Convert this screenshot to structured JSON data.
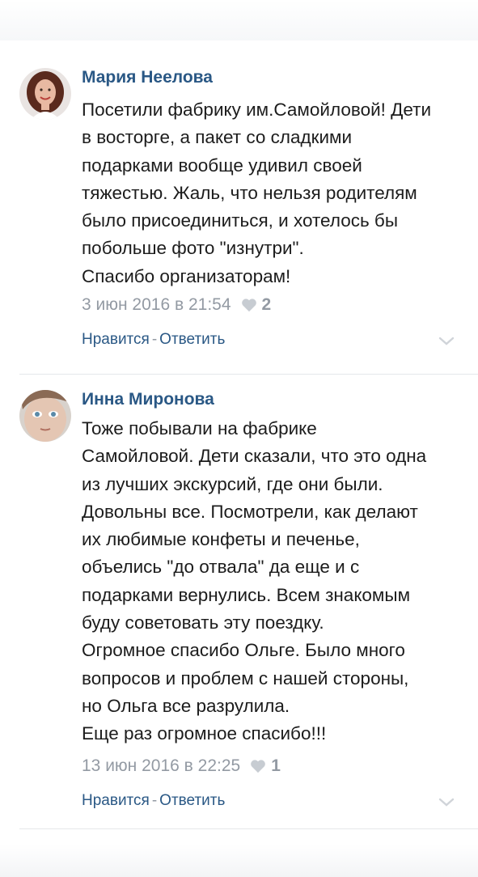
{
  "colors": {
    "link": "#2a5885",
    "meta": "#939aa3",
    "text": "#1c1c1c",
    "divider": "#e5e7ea"
  },
  "comments": [
    {
      "author": "Мария Неелова",
      "text": "Посетили фабрику им.Самойловой! Дети\nв восторге, а пакет со сладкими\nподарками вообще удивил своей\nтяжестью. Жаль, что нельзя родителям\nбыло присоединиться, и хотелось бы\nпобольше фото \"изнутри\".\nСпасибо организаторам!",
      "date": "3 июн 2016 в 21:54",
      "likes": "2",
      "like_label": "Нравится",
      "separator": "-",
      "reply_label": "Ответить",
      "icons": {
        "heart": "heart-icon",
        "chevron": "chevron-down-icon"
      }
    },
    {
      "author": "Инна Миронова",
      "text": "Тоже побывали на фабрике\nСамойловой. Дети сказали, что это одна\nиз лучших экскурсий, где они были.\nДовольны все. Посмотрели, как делают\nих любимые конфеты и печенье,\nобъелись \"до отвала\" да еще и с\nподарками вернулись. Всем знакомым\nбуду советовать эту поездку.\nОгромное спасибо Ольге. Было много\nвопросов и проблем с нашей стороны,\nно Ольга все разрулила.\nЕще раз огромное спасибо!!!",
      "date": "13 июн 2016 в 22:25",
      "likes": "1",
      "like_label": "Нравится",
      "separator": "-",
      "reply_label": "Ответить",
      "icons": {
        "heart": "heart-icon",
        "chevron": "chevron-down-icon"
      }
    }
  ]
}
